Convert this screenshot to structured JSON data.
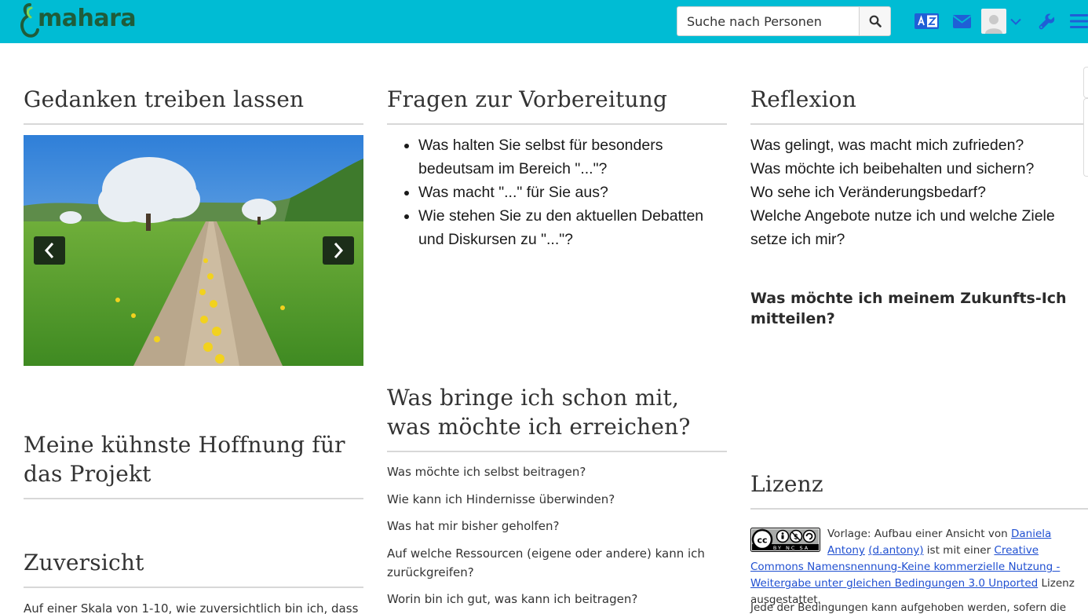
{
  "header": {
    "logo_text": "mahara",
    "search": {
      "placeholder": "Suche nach Personen",
      "value": ""
    },
    "icons": [
      "language-icon",
      "mail-icon",
      "user-avatar",
      "chevron-down-icon",
      "wrench-icon",
      "menu-icon"
    ]
  },
  "colors": {
    "header_bg": "#00bcd4",
    "header_icon": "#1f5fd6",
    "link": "#1f4fd1",
    "divider": "#d8d8d8",
    "logo": "#1f5c3a"
  },
  "blocks": {
    "gedanken": {
      "title": "Gedanken treiben lassen"
    },
    "hoffnung": {
      "title_line1": "Meine kühnste Hoffnung für",
      "title_line2": "das Projekt"
    },
    "zuversicht": {
      "title": "Zuversicht",
      "text": "Auf einer Skala von 1-10, wie zuversichtlich bin ich, dass"
    },
    "fragen": {
      "title": "Fragen zur Vorbereitung",
      "items": [
        "Was halten Sie selbst für besonders bedeutsam im Bereich \"...\"?",
        "Was macht \"...\" für Sie aus?",
        "Wie stehen Sie zu den aktuellen Debatten und Diskursen zu \"...\"?"
      ]
    },
    "bringe": {
      "title_line1": "Was bringe ich schon mit,",
      "title_line2": "was möchte ich erreichen?",
      "items": [
        "Was möchte ich selbst beitragen?",
        "Wie kann ich Hindernisse überwinden?",
        "Was hat mir bisher geholfen?",
        "Auf welche Ressourcen (eigene oder andere) kann ich zurückgreifen?",
        "Worin bin ich gut, was kann ich beitragen?"
      ]
    },
    "reflexion": {
      "title": "Reflexion",
      "lines": [
        "Was gelingt, was macht mich zufrieden?",
        "Was möchte ich beibehalten und sichern?",
        "Wo sehe ich Veränderungsbedarf?",
        "Welche Angebote nutze ich und welche Ziele setze ich mir?"
      ],
      "zukunft": "Was möchte ich meinem Zukunfts-Ich mitteilen?"
    },
    "lizenz": {
      "title": "Lizenz",
      "badge_text": "BY NC SA",
      "text_prefix": "Vorlage: Aufbau einer Ansicht von ",
      "author_link": "Daniela Antony",
      "username_link": "(d.antony)",
      "text_middle": " ist mit einer ",
      "license_link": "Creative Commons Namensnennung-Keine kommerzielle Nutzung - Weitergabe unter gleichen Bedingungen 3.0 Unported",
      "text_suffix": " Lizenz ausgestattet.",
      "more": "Jede der Bedingungen kann aufgehoben werden, sofern die"
    }
  }
}
